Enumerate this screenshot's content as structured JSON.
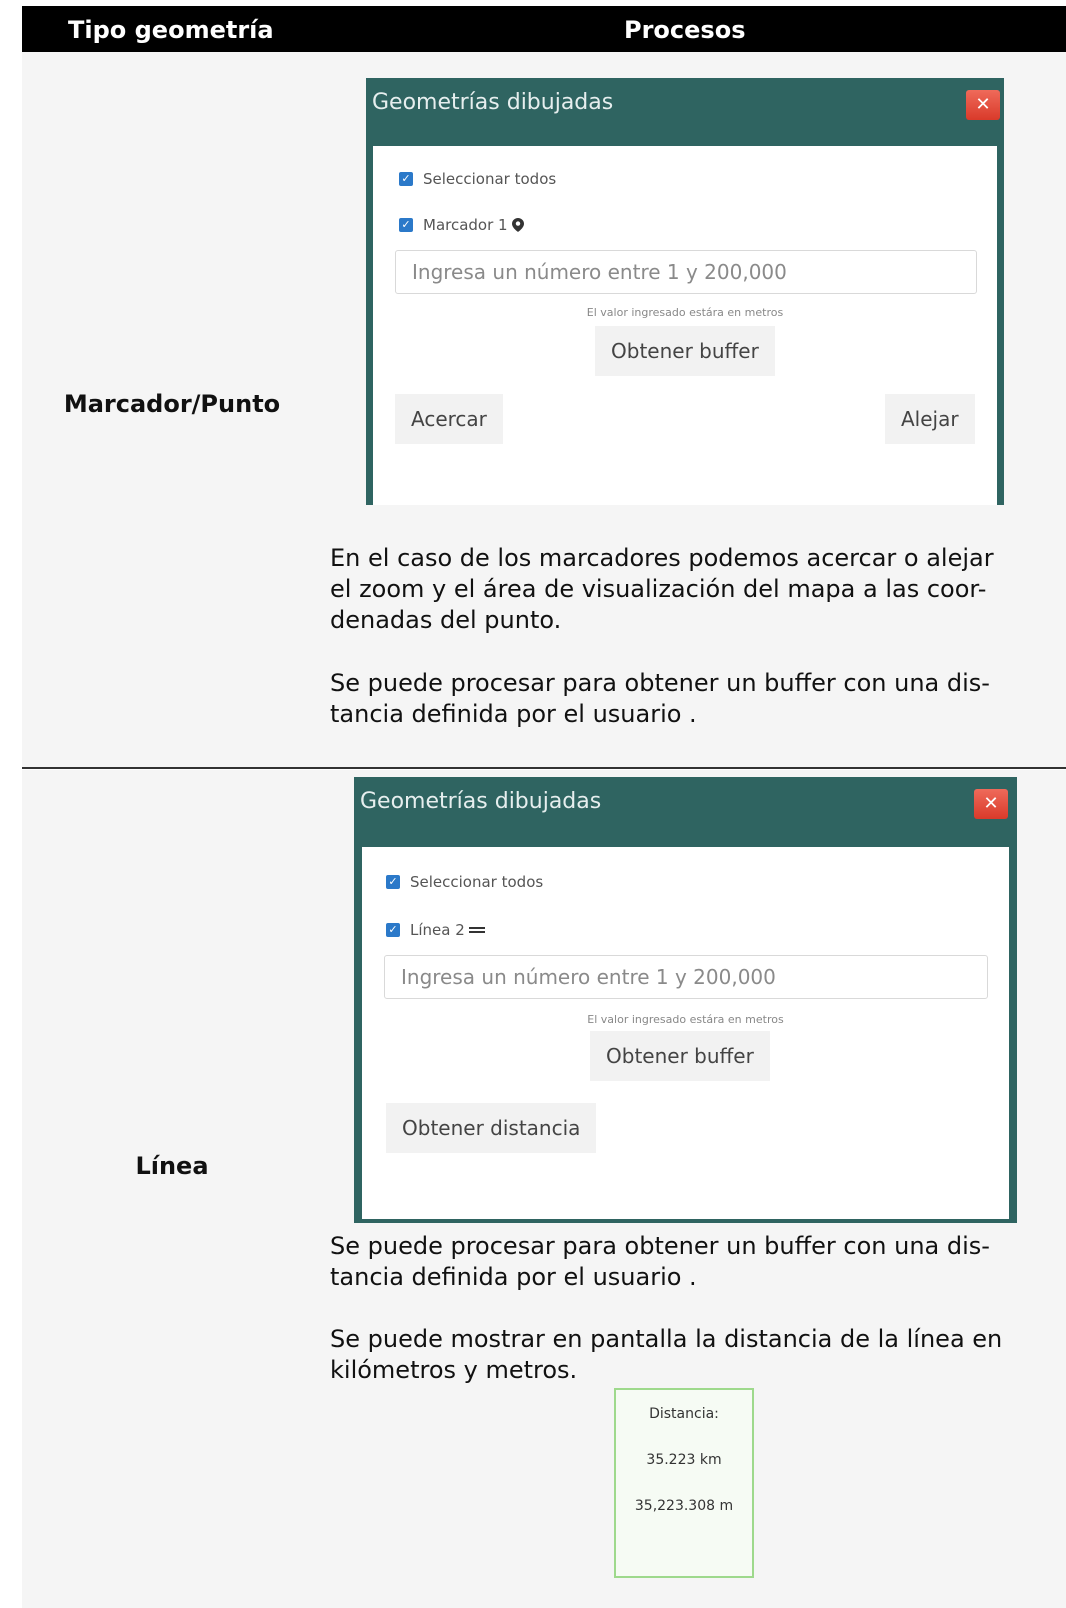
{
  "header": {
    "col1": "Tipo geometría",
    "col2": "Procesos"
  },
  "rows": [
    {
      "type": "Marcador/Punto",
      "panel": {
        "title": "Geometrías dibujadas",
        "close": "✕",
        "select_all": "Seleccionar todos",
        "item": "Marcador 1",
        "input_placeholder": "Ingresa un número entre 1 y 200,000",
        "hint": "El valor ingresado estára en metros",
        "buffer_button": "Obtener buffer",
        "zoom_in_button": "Acercar",
        "zoom_out_button": "Alejar"
      },
      "paragraphs": [
        [
          "En el caso de los marcadores podemos acercar o alejar",
          "el zoom y el área de visualización del mapa a las coor-",
          "denadas del punto."
        ],
        [
          "Se puede procesar para obtener un buffer con una dis-",
          "tancia definida por el usuario ."
        ]
      ]
    },
    {
      "type": "Línea",
      "panel": {
        "title": "Geometrías dibujadas",
        "close": "✕",
        "select_all": "Seleccionar todos",
        "item": "Línea 2",
        "input_placeholder": "Ingresa un número entre 1 y 200,000",
        "hint": "El valor ingresado estára en metros",
        "buffer_button": "Obtener buffer",
        "distance_button": "Obtener distancia"
      },
      "paragraphs": [
        [
          "Se puede procesar para obtener un buffer con una dis-",
          "tancia definida por el usuario ."
        ],
        [
          "Se puede mostrar en pantalla la distancia de la línea en",
          "kilómetros y metros."
        ]
      ],
      "distance_card": {
        "label": "Distancia:",
        "km": "35.223 km",
        "m": "35,223.308 m"
      }
    }
  ]
}
